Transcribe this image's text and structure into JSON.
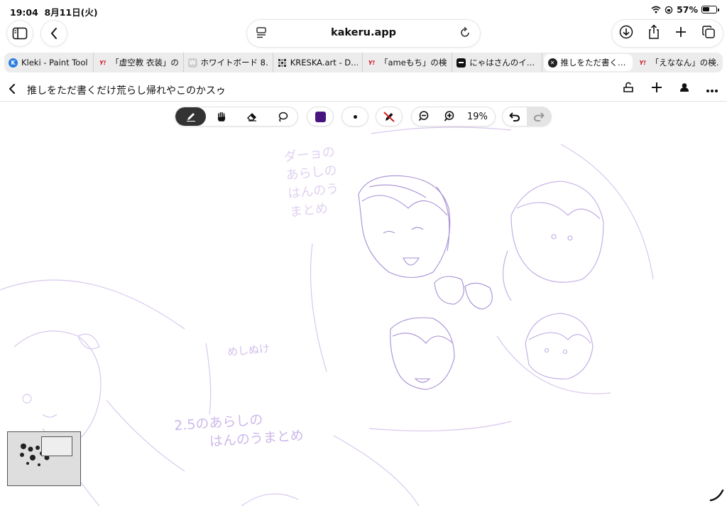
{
  "status_bar": {
    "time": "19:04",
    "date": "8月11日(火)",
    "battery": "57%",
    "battery_level": 0.57
  },
  "url_bar": {
    "domain": "kakeru.app"
  },
  "tabs": [
    {
      "title": "Kleki - Paint Tool",
      "favicon": "kleki-icon"
    },
    {
      "title": "「虚空教 衣装」の…",
      "favicon": "yahoo-icon"
    },
    {
      "title": "ホワイトボード 8…",
      "favicon": "w-icon"
    },
    {
      "title": "KRESKA.art - D…",
      "favicon": "kreska-icon"
    },
    {
      "title": "「ameもち」の検…",
      "favicon": "yahoo-icon"
    },
    {
      "title": "にゃはさんのイ…",
      "favicon": "nyaha-icon"
    },
    {
      "title": "推しをただ書く…",
      "favicon": "close-icon",
      "active": true
    },
    {
      "title": "「えななん」の検…",
      "favicon": "yahoo-icon"
    }
  ],
  "page": {
    "title": "推しをただ書くだけ荒らし帰れやこのかスゥ"
  },
  "drawing_toolbar": {
    "tools": [
      "pen-icon",
      "hand-icon",
      "eraser-icon",
      "lasso-icon"
    ],
    "active_tool": "pen-icon",
    "color": "#4a1480",
    "zoom": "19%"
  },
  "canvas_text": {
    "note1": "ダーョの",
    "note2": "あらしの",
    "note3": "はんのう",
    "note4": "まとめ",
    "note5": "めしぬけ",
    "note6": "2.5のあらしの",
    "note7": "はんのうまとめ"
  },
  "colors": {
    "sketch": "#a78fd4",
    "sketch_light": "#d8c8ee",
    "accent_dark": "#333333"
  }
}
